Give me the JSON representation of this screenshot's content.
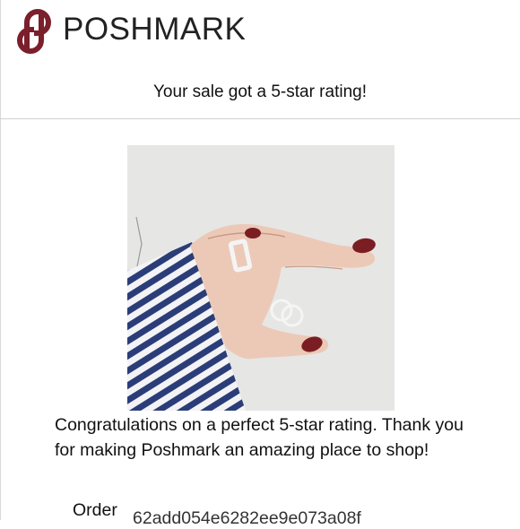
{
  "header": {
    "brand": "POSHMARK",
    "brand_color": "#7a1f2b",
    "logo_icon": "poshmark-logo-icon"
  },
  "headline": "Your sale got a 5-star rating!",
  "product_image": {
    "alt": "Silver rings on hand with striped sleeve"
  },
  "message": "Congratulations on a perfect 5-star rating. Thank you for making Poshmark an amazing place to shop!",
  "order": {
    "label": "Order",
    "id": "62add054e6282ee9e073a08f"
  }
}
